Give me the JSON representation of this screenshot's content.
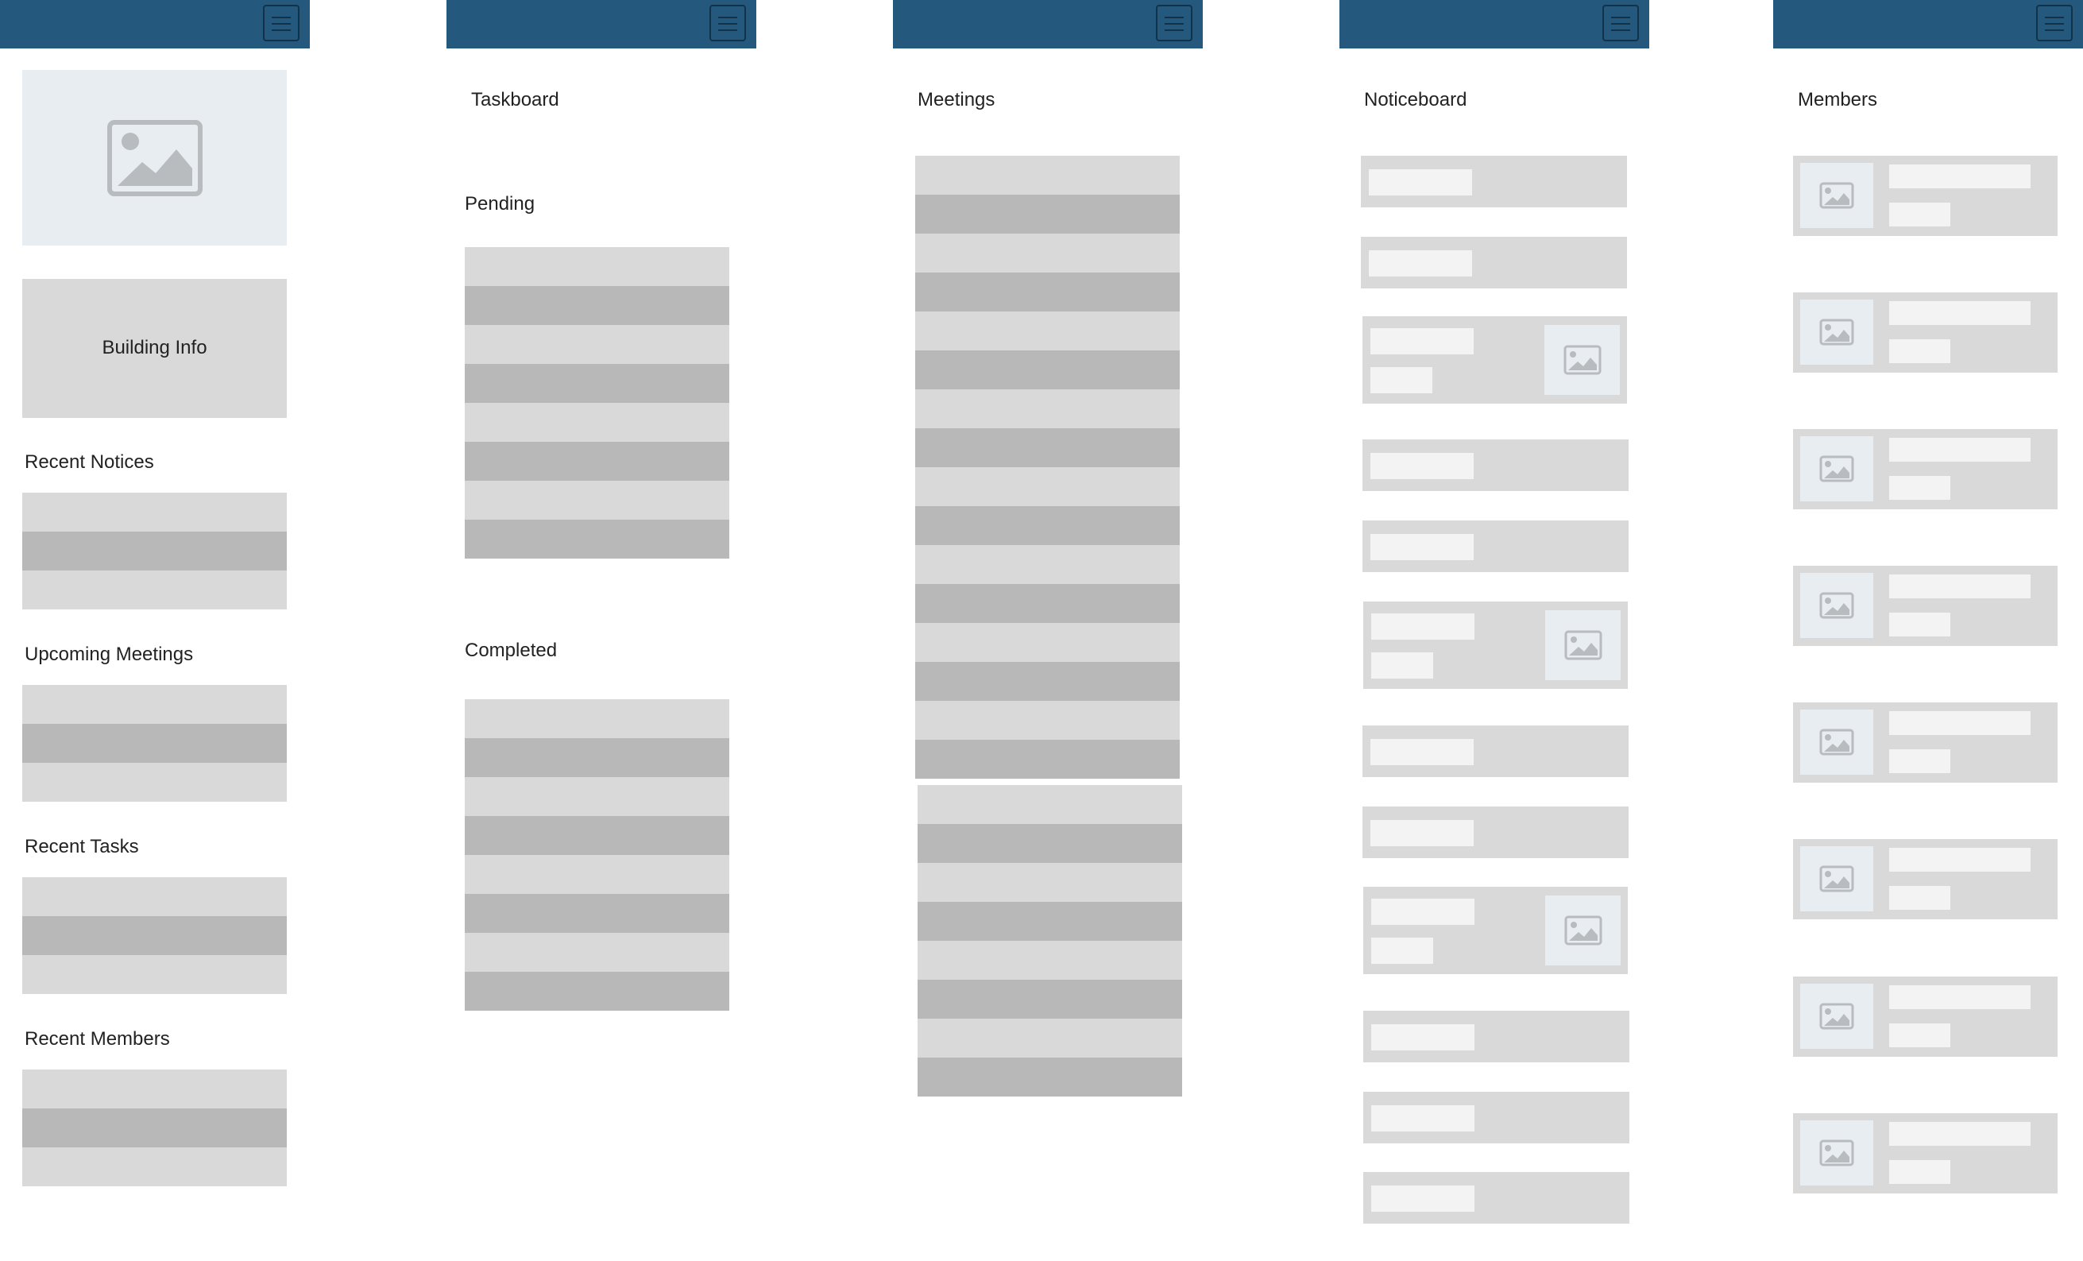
{
  "colors": {
    "header": "#24587c",
    "placeholder_light": "#d9d9d9",
    "placeholder_dark": "#b8b8b8",
    "image_bg": "#e7edf0"
  },
  "icons": {
    "menu": "menu-icon",
    "image": "image-icon"
  },
  "dashboard": {
    "building_info": "Building Info",
    "recent_notices": "Recent Notices",
    "upcoming_meetings": "Upcoming Meetings",
    "recent_tasks": "Recent Tasks",
    "recent_members": "Recent Members"
  },
  "taskboard": {
    "title": "Taskboard",
    "pending": "Pending",
    "completed": "Completed"
  },
  "meetings": {
    "title": "Meetings"
  },
  "noticeboard": {
    "title": "Noticeboard"
  },
  "members": {
    "title": "Members"
  }
}
